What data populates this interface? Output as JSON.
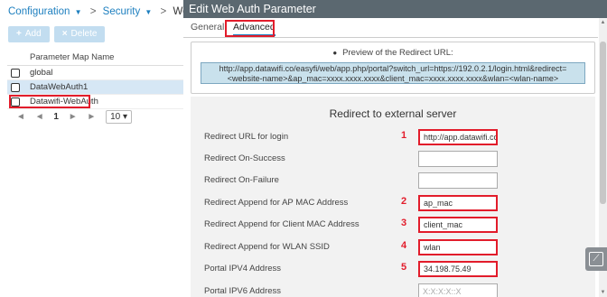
{
  "breadcrumb": {
    "configuration": "Configuration",
    "security": "Security",
    "current": "Web Auth",
    "caret": "▼",
    "separator": ">"
  },
  "toolbar": {
    "add_label": "Add",
    "delete_label": "Delete",
    "add_symbol": "+",
    "delete_symbol": "×"
  },
  "list": {
    "header": "Parameter Map Name",
    "rows": [
      {
        "name": "global"
      },
      {
        "name": "DataWebAuth1"
      },
      {
        "name": "Datawifi-WebAuth"
      }
    ]
  },
  "pager": {
    "first": "◄",
    "prev": "◄",
    "page": "1",
    "next": "►",
    "last": "►",
    "page_size": "10 ▾"
  },
  "dialog": {
    "title": "Edit Web Auth Parameter",
    "tabs": {
      "general": "General",
      "advanced": "Advanced"
    },
    "preview": {
      "heading": "Preview of the Redirect URL:",
      "info_glyph": "●",
      "url": "http://app.datawifi.co/easyfi/web/app.php/portal?switch_url=https://192.0.2.1/login.html&redirect=<website-name>&ap_mac=xxxx.xxxx.xxxx&client_mac=xxxx.xxxx.xxxx&wlan=<wlan-name>"
    },
    "section_title": "Redirect to external server",
    "fields": [
      {
        "label": "Redirect URL for login",
        "value": "http://app.datawifi.co/easyfi",
        "marker": "1"
      },
      {
        "label": "Redirect On-Success",
        "value": "",
        "marker": ""
      },
      {
        "label": "Redirect On-Failure",
        "value": "",
        "marker": ""
      },
      {
        "label": "Redirect Append for AP MAC Address",
        "value": "ap_mac",
        "marker": "2"
      },
      {
        "label": "Redirect Append for Client MAC Address",
        "value": "client_mac",
        "marker": "3"
      },
      {
        "label": "Redirect Append for WLAN SSID",
        "value": "wlan",
        "marker": "4"
      },
      {
        "label": "Portal IPV4 Address",
        "value": "34.198.75.49",
        "marker": "5"
      },
      {
        "label": "Portal IPV6 Address",
        "placeholder": "X:X:X:X::X",
        "marker": ""
      }
    ]
  },
  "colors": {
    "accent": "#1d7fbf",
    "annotation": "#e21c2b",
    "title_bar": "#5b6870"
  }
}
